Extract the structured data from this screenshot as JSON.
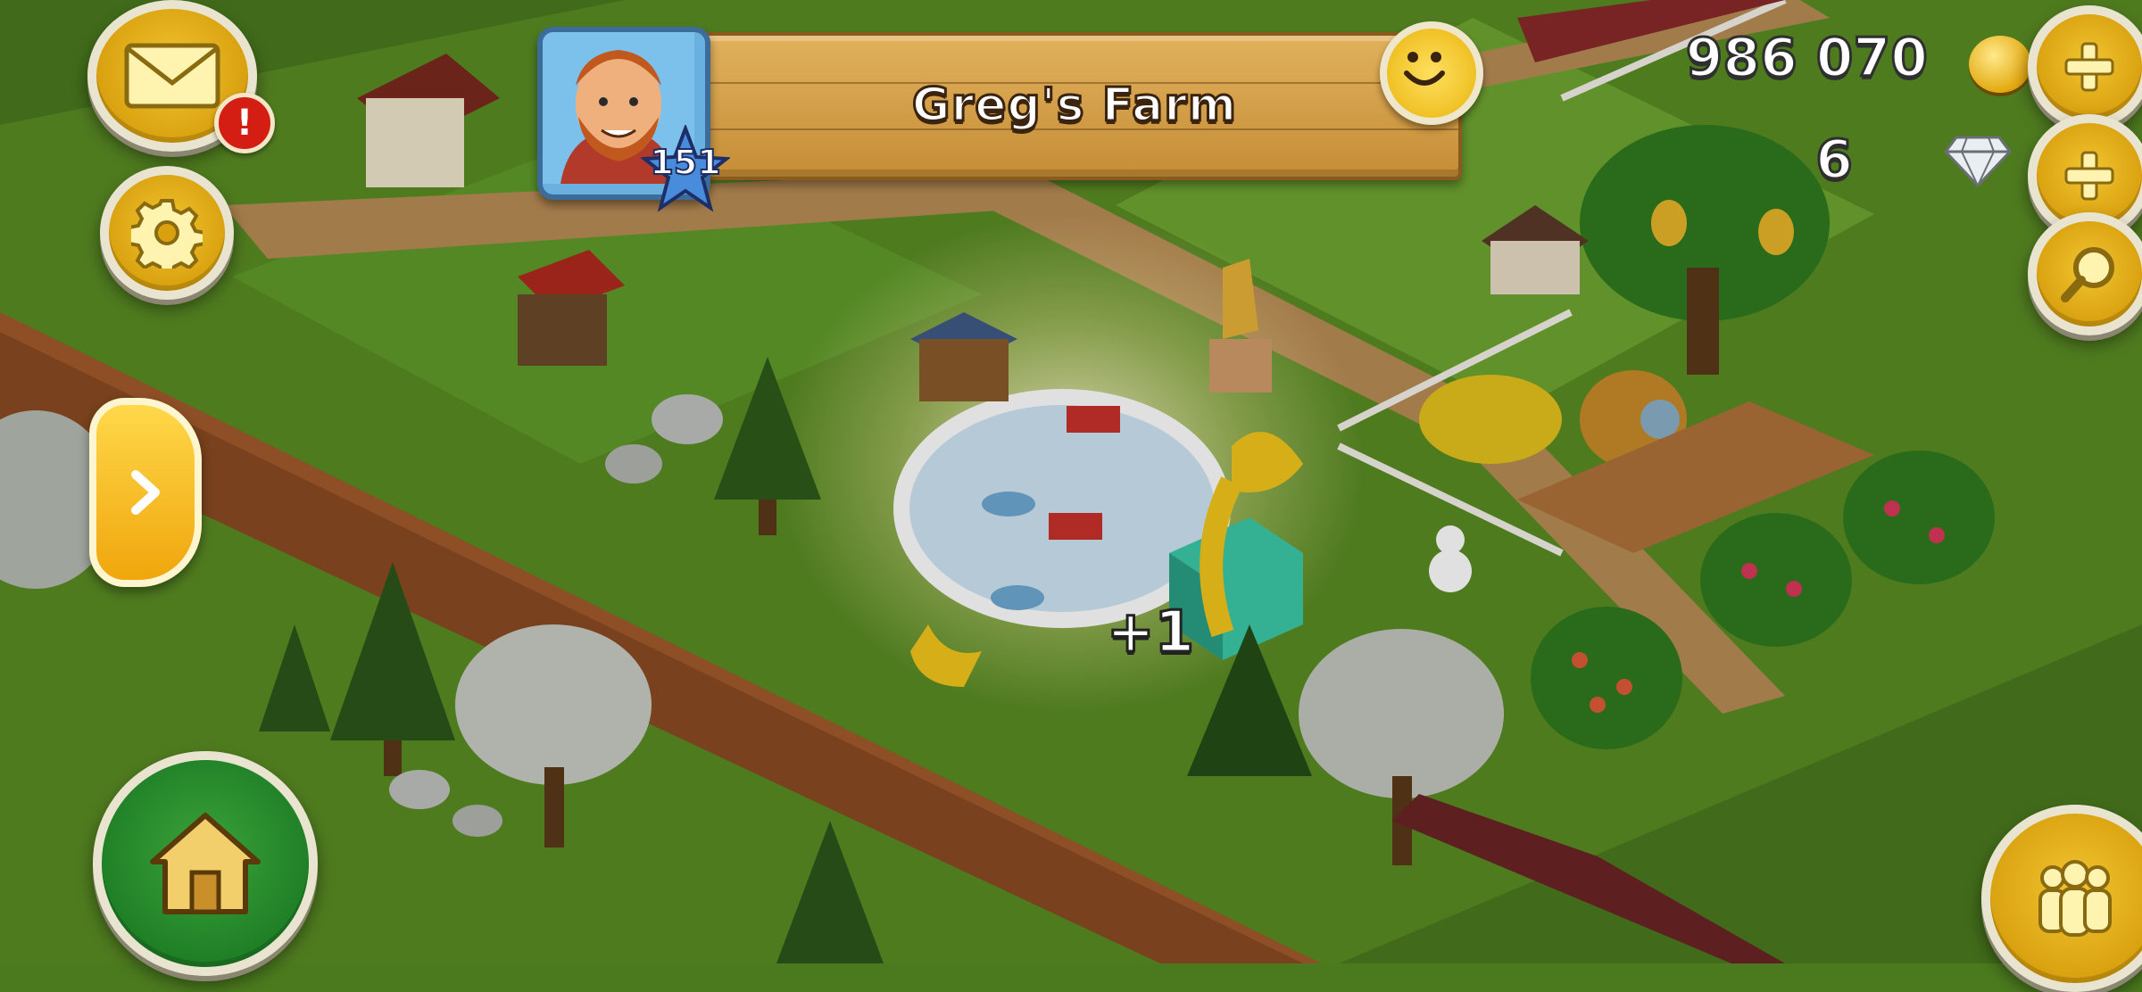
{
  "header": {
    "farm_name": "Greg's Farm",
    "player_level": "151"
  },
  "currency": {
    "coins": "986 070",
    "gems": "6"
  },
  "notifications": {
    "mail_alert": "!"
  },
  "reward": {
    "popup_text": "+1"
  },
  "icons": {
    "mail": "envelope-icon",
    "settings": "gear-icon",
    "home": "house-icon",
    "expand": "chevron-right-icon",
    "coins": "coin-icon",
    "gems": "diamond-icon",
    "add": "plus-icon",
    "search": "magnifier-icon",
    "friends": "people-icon",
    "mood": "smiley-icon"
  },
  "colors": {
    "hud_gold": "#e2ad17",
    "hud_rim": "#e9e4cf",
    "banner_wood": "#d4a04a",
    "home_green": "#1f7f26",
    "alert_red": "#d41e13",
    "grass": "#4b7a1e",
    "dirt_path": "#8a4a22"
  }
}
